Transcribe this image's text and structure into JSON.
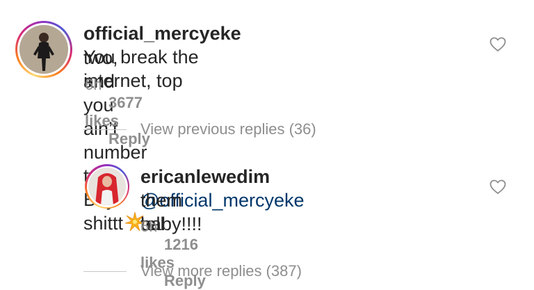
{
  "comment": {
    "username": "official_mercyeke",
    "text_1": " You break the internet, top",
    "text_2": "two, and you ain’t number two. Bey shittt",
    "emoji_icon": "sparkle-star-icon",
    "time": "6h",
    "likes": "3677 likes",
    "reply": "Reply"
  },
  "view_previous": "View previous replies (36)",
  "reply_comment": {
    "username": "ericanlewedim",
    "mention": "@official_mercyeke",
    "text_1": " tell",
    "text_2": "them baby!!!!",
    "time": "6h",
    "likes": "1216 likes",
    "reply": "Reply"
  },
  "view_more": "View more replies (387)",
  "colors": {
    "text": "#262626",
    "muted": "#8e8e8e",
    "mention": "#00376b"
  }
}
